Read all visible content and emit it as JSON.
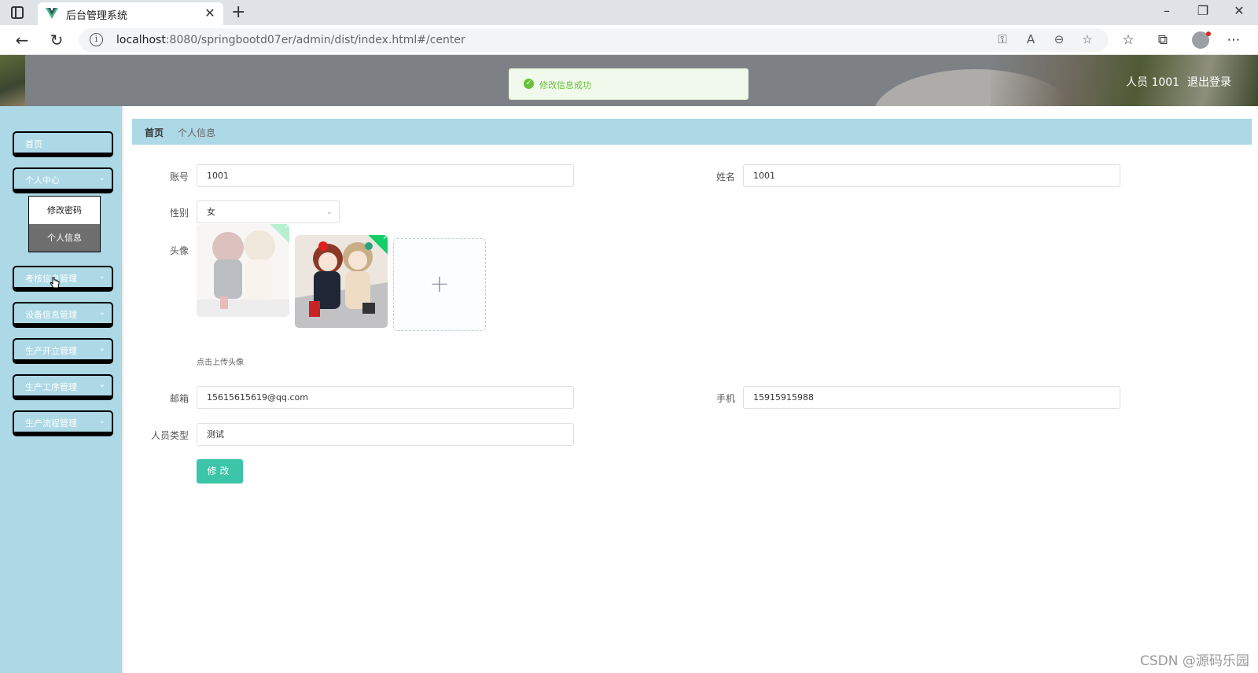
{
  "browser": {
    "tab_title": "后台管理系统",
    "url_host": "localhost",
    "url_rest": ":8080/springbootd07er/admin/dist/index.html#/center"
  },
  "header": {
    "user_label": "人员 1001",
    "logout_label": "退出登录"
  },
  "toast": {
    "message": "修改信息成功",
    "color": "#67c23a"
  },
  "sidebar": {
    "background": "#add8e6",
    "items": [
      {
        "label": "首页",
        "has_children": false
      },
      {
        "label": "个人中心",
        "has_children": true
      },
      {
        "label": "考核信息管理",
        "has_children": true
      },
      {
        "label": "设备信息管理",
        "has_children": true
      },
      {
        "label": "生产开立管理",
        "has_children": true
      },
      {
        "label": "生产工序管理",
        "has_children": true
      },
      {
        "label": "生产流程管理",
        "has_children": true
      }
    ],
    "submenu": [
      {
        "label": "修改密码",
        "active": false
      },
      {
        "label": "个人信息",
        "active": true
      }
    ]
  },
  "breadcrumb": {
    "home": "首页",
    "current": "个人信息"
  },
  "form": {
    "account": {
      "label": "账号",
      "value": "1001"
    },
    "name": {
      "label": "姓名",
      "value": "1001"
    },
    "gender": {
      "label": "性别",
      "value": "女"
    },
    "avatar": {
      "label": "头像",
      "hint": "点击上传头像"
    },
    "email": {
      "label": "邮箱",
      "value": "15615615619@qq.com"
    },
    "phone": {
      "label": "手机",
      "value": "15915915988"
    },
    "type": {
      "label": "人员类型",
      "value": "测试"
    },
    "submit_label": "修改",
    "accent": "#3cc5a8"
  },
  "watermark": "CSDN @源码乐园"
}
